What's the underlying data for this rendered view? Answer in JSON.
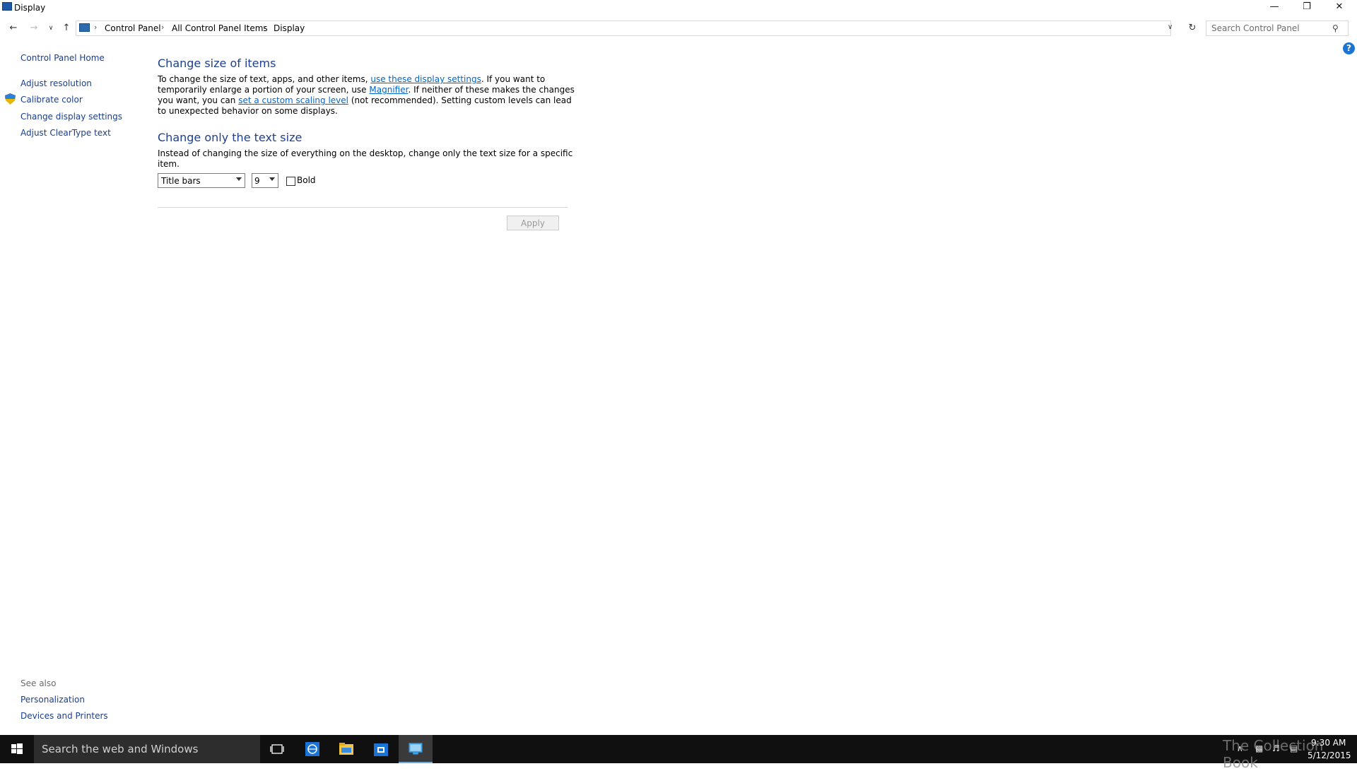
{
  "window": {
    "title": "Display"
  },
  "breadcrumb": [
    "Control Panel",
    "All Control Panel Items",
    "Display"
  ],
  "search": {
    "placeholder": "Search Control Panel"
  },
  "left_nav": {
    "home": "Control Panel Home",
    "items": [
      "Adjust resolution",
      "Calibrate color",
      "Change display settings",
      "Adjust ClearType text"
    ],
    "see_also_title": "See also",
    "see_also": [
      "Personalization",
      "Devices and Printers"
    ]
  },
  "main": {
    "section1_title": "Change size of items",
    "section1_p1": "To change the size of text, apps, and other items,",
    "section1_link1": "use these display settings",
    "section1_p2": ".  If you want to temporarily enlarge a portion of your screen, use",
    "section1_link2": "Magnifier",
    "section1_p3": ".  If neither of these makes the changes you want, you can",
    "section1_link3": "set a custom scaling level",
    "section1_p4": "(not recommended).  Setting custom levels can lead to unexpected behavior on some displays.",
    "section2_title": "Change only the text size",
    "section2_desc": "Instead of changing the size of everything on the desktop, change only the text size for a specific item.",
    "item_select": "Title bars",
    "size_select": "9",
    "bold_label": "Bold",
    "apply_label": "Apply"
  },
  "taskbar": {
    "search_text": "Search the web and Windows",
    "time": "9:30 AM",
    "date": "5/12/2015",
    "watermark": "The Collection Book"
  }
}
